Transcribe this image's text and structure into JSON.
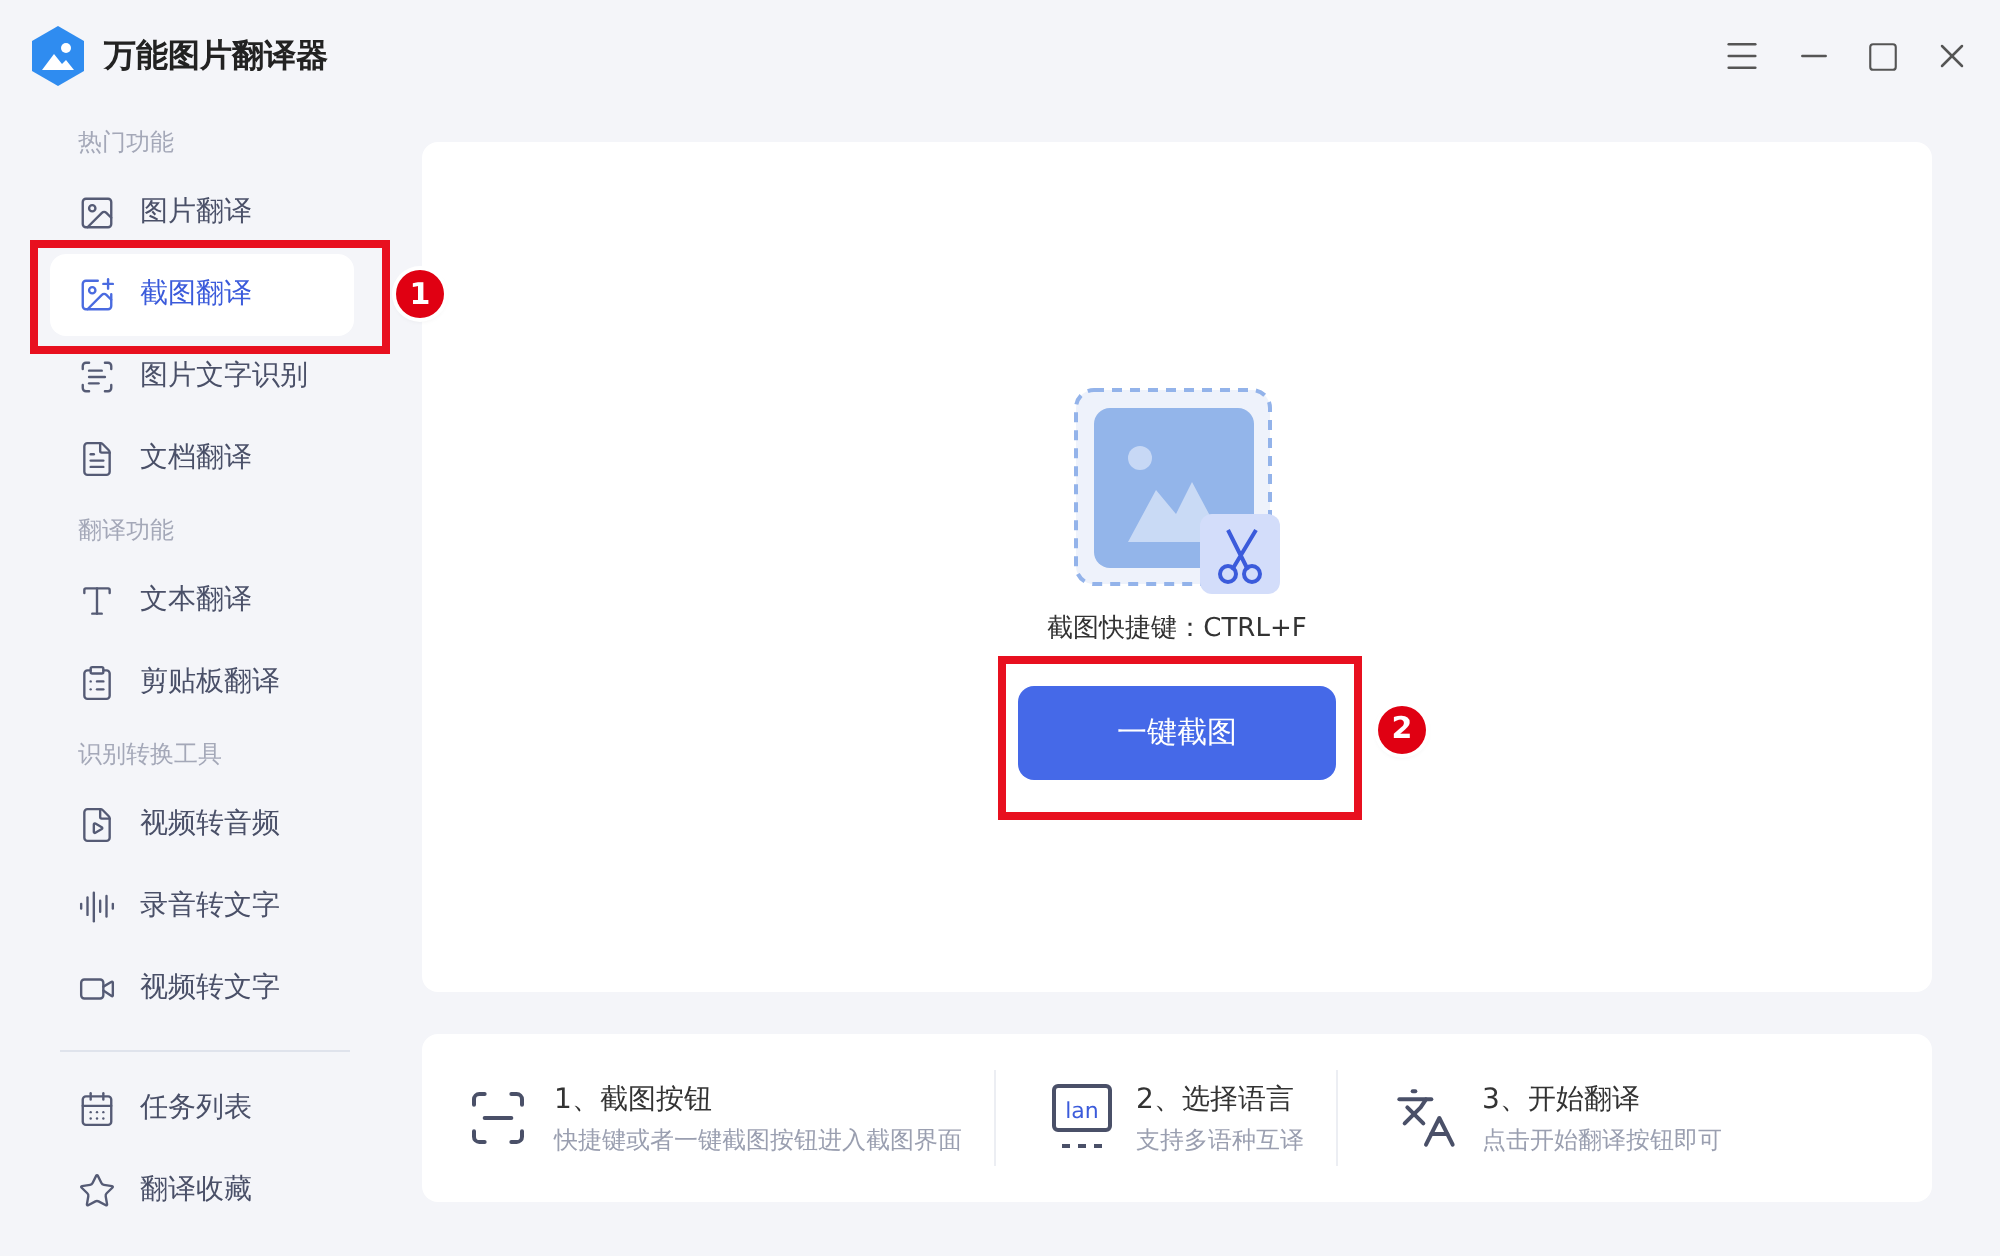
{
  "app": {
    "title": "万能图片翻译器"
  },
  "sidebar": {
    "sections": [
      {
        "title": "热门功能",
        "items": [
          {
            "label": "图片翻译",
            "selected": false
          },
          {
            "label": "截图翻译",
            "selected": true,
            "callout": "1"
          },
          {
            "label": "图片文字识别",
            "selected": false
          },
          {
            "label": "文档翻译",
            "selected": false
          }
        ]
      },
      {
        "title": "翻译功能",
        "items": [
          {
            "label": "文本翻译",
            "selected": false
          },
          {
            "label": "剪贴板翻译",
            "selected": false
          }
        ]
      },
      {
        "title": "识别转换工具",
        "items": [
          {
            "label": "视频转音频",
            "selected": false
          },
          {
            "label": "录音转文字",
            "selected": false
          },
          {
            "label": "视频转文字",
            "selected": false
          }
        ]
      }
    ],
    "bottom_items": [
      {
        "label": "任务列表",
        "selected": false
      },
      {
        "label": "翻译收藏",
        "selected": false
      }
    ]
  },
  "main": {
    "shortcut_hint": "截图快捷键：CTRL+F",
    "capture_button": {
      "label": "一键截图",
      "callout": "2"
    }
  },
  "steps": [
    {
      "title": "1、截图按钮",
      "description": "快捷键或者一键截图按钮进入截图界面"
    },
    {
      "title": "2、选择语言",
      "description": "支持多语种互译",
      "icon_text": "lan"
    },
    {
      "title": "3、开始翻译",
      "description": "点击开始翻译按钮即可"
    }
  ]
}
